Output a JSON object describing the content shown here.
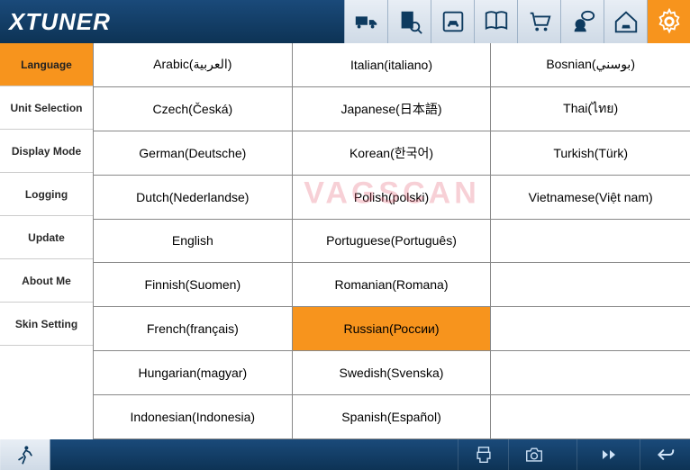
{
  "app": {
    "logo_text": "XTUNER"
  },
  "toolbar": {
    "items": [
      {
        "name": "truck-icon"
      },
      {
        "name": "diag-search-icon"
      },
      {
        "name": "car-doc-icon"
      },
      {
        "name": "book-icon"
      },
      {
        "name": "cart-icon"
      },
      {
        "name": "feedback-icon"
      },
      {
        "name": "home-icon"
      },
      {
        "name": "settings-icon",
        "active": true
      }
    ]
  },
  "sidebar": {
    "items": [
      {
        "label": "Language",
        "active": true
      },
      {
        "label": "Unit Selection"
      },
      {
        "label": "Display Mode"
      },
      {
        "label": "Logging"
      },
      {
        "label": "Update"
      },
      {
        "label": "About Me"
      },
      {
        "label": "Skin Setting"
      }
    ]
  },
  "languages": {
    "col0": [
      "Arabic(العربية)",
      "Czech(Česká)",
      "German(Deutsche)",
      "Dutch(Nederlandse)",
      "English",
      "Finnish(Suomen)",
      "French(français)",
      "Hungarian(magyar)",
      "Indonesian(Indonesia)"
    ],
    "col1": [
      "Italian(italiano)",
      "Japanese(日本語)",
      "Korean(한국어)",
      "Polish(polski)",
      "Portuguese(Português)",
      "Romanian(Romana)",
      "Russian(России)",
      "Swedish(Svenska)",
      "Spanish(Español)"
    ],
    "col2": [
      "Bosnian(بوسني)",
      "Thai(ไทย)",
      "Turkish(Türk)",
      "Vietnamese(Việt nam)",
      "",
      "",
      "",
      "",
      ""
    ],
    "selected": "Russian(России)"
  },
  "watermark": "VAGSCAN",
  "footer": {
    "left": [
      "run-icon"
    ],
    "right": [
      "print-icon",
      "camera-icon",
      "sep",
      "forward-icon",
      "back-icon"
    ]
  }
}
